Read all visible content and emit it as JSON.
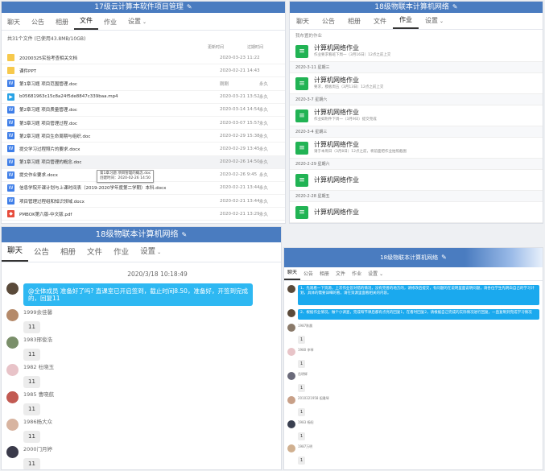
{
  "files_panel": {
    "title": "17级云计算本软件项目管理",
    "tabs": [
      {
        "label": "聊天"
      },
      {
        "label": "公告"
      },
      {
        "label": "相册"
      },
      {
        "label": "文件",
        "active": true
      },
      {
        "label": "作业"
      },
      {
        "label": "设置"
      }
    ],
    "summary": "共31个文件 (已使用43.8MB/10GB)",
    "columns": {
      "date": "更新时间",
      "expire": "过期时间"
    },
    "files": [
      {
        "type": "folder",
        "name": "20200325实验考查相关文档",
        "date": "2020-03-23 11:22",
        "expire": ""
      },
      {
        "type": "folder",
        "name": "课件PPT",
        "date": "2020-02-21 14:43",
        "expire": ""
      },
      {
        "type": "word",
        "name": "第1章习题 项目范围管理.doc",
        "date": "刚刚",
        "expire": "永久"
      },
      {
        "type": "video",
        "name": "b05681963c15c8a24f5de8847c339baa.mp4",
        "date": "2020-03-21 13:52",
        "expire": "永久"
      },
      {
        "type": "word",
        "name": "第2章习题 项目质量管理.doc",
        "date": "2020-03-14 14:54",
        "expire": "永久"
      },
      {
        "type": "word",
        "name": "第3章习题 项目管理过程.doc",
        "date": "2020-03-07 15:57",
        "expire": "永久"
      },
      {
        "type": "word",
        "name": "第2章习题 项目生命周期与组织.doc",
        "date": "2020-02-29 15:38",
        "expire": "永久"
      },
      {
        "type": "word",
        "name": "提交学习过程照片的要求.docx",
        "date": "2020-02-29 13:45",
        "expire": "永久"
      },
      {
        "type": "word",
        "name": "第1章习题 项目管理的概念.doc",
        "date": "2020-02-26 14:50",
        "expire": "永久",
        "selected": true
      },
      {
        "type": "word",
        "name": "提交作业要求.docx",
        "date": "2020-02-26 9:45",
        "expire": "永久"
      },
      {
        "type": "word",
        "name": "信息学院开课计划与上课时间表（2019-2020学年度第二学期）本科.docx",
        "date": "2020-02-21 13:44",
        "expire": "永久"
      },
      {
        "type": "word",
        "name": "项目管理过程组和知识领域.docx",
        "date": "2020-02-21 13:44",
        "expire": "永久"
      },
      {
        "type": "pdf",
        "name": "PMBOK第六版-中文版.pdf",
        "date": "2020-02-21 13:29",
        "expire": "永久"
      }
    ],
    "tooltip": {
      "line1": "第1章习题 项目管理的概念.doc",
      "line2": "创建时间：2020-02-26 14:50"
    }
  },
  "homework_panel": {
    "title": "18级物联本计算机网络",
    "tabs": [
      {
        "label": "聊天"
      },
      {
        "label": "公告"
      },
      {
        "label": "相册"
      },
      {
        "label": "文件"
      },
      {
        "label": "作业",
        "active": true
      },
      {
        "label": "设置"
      }
    ],
    "section": "我布置的作业",
    "items": [
      {
        "date": "",
        "title": "计算机网络作业",
        "sub": "作业要求看班下周一（3月16日）12点之前上交"
      },
      {
        "date": "2020-3-11 星期三",
        "title": "计算机网络作业",
        "sub": "要求，模板周五（3月13日）12点之前上交"
      },
      {
        "date": "2020-3-7 星期六",
        "title": "计算机网络作业",
        "sub": "作业如附件下周一（3月9日）提交完成"
      },
      {
        "date": "2020-3-4 星期三",
        "title": "计算机网络作业",
        "sub": "请于本周日（3月8日）12点之前，将前面把作业拍照截图"
      },
      {
        "date": "2020-2-29 星期六",
        "title": "计算机网络作业",
        "sub": ""
      },
      {
        "date": "2020-2-28 星期五",
        "title": "计算机网络作业",
        "sub": ""
      },
      {
        "date": "2020-2-26 星期三",
        "title": "计算机网络作业",
        "sub": ""
      }
    ]
  },
  "chat_panel": {
    "title": "18级物联本计算机网络",
    "tabs": [
      {
        "label": "聊天",
        "active": true
      },
      {
        "label": "公告"
      },
      {
        "label": "相册"
      },
      {
        "label": "文件"
      },
      {
        "label": "作业"
      },
      {
        "label": "设置"
      }
    ],
    "timestamp": "2020/3/18 10:18:49",
    "announcement": "@全体成员 准备好了吗? 直课室已开启签到，截止时间8.50，准备好，开签到完成的，回复11",
    "messages": [
      {
        "name": "1999余佳馨",
        "text": "11",
        "color": "#b58a6a"
      },
      {
        "name": "1983邢俊浩",
        "text": "11",
        "color": "#7a8f6a"
      },
      {
        "name": "1982 杜晓玉",
        "text": "11",
        "color": "#e8c3c8"
      },
      {
        "name": "1985 曹晓航",
        "text": "11",
        "color": "#c25a52"
      },
      {
        "name": "1986杨大众",
        "text": "11",
        "color": "#d8b4a0"
      },
      {
        "name": "2000门月婷",
        "text": "11",
        "color": "#3a3a4a"
      },
      {
        "name": "1990 李璐",
        "text": "",
        "color": "#a0a8b8"
      }
    ]
  },
  "small_chat_panel": {
    "title": "18级物联本计算机网络",
    "tabs": [
      {
        "label": "聊天",
        "active": true
      },
      {
        "label": "公告"
      },
      {
        "label": "相册"
      },
      {
        "label": "文件"
      },
      {
        "label": "作业"
      },
      {
        "label": "设置"
      }
    ],
    "announcement1": "1、先观看一下资源，上次作业答对错的情况，没有完善的地方的，请修改后提交，有问题的在说明里面说明问题，请各位学生先明白自己的学习计划，具体的需要详细的看，请在资源里面看相关的内容。",
    "announcement2": "2、根据作业情况，做个小调查，完成每节课后都有点亮的回复1，在看时回复2，请根据自己完成的实际情况进行回复，一直复制到完成学习情况",
    "messages": [
      {
        "name": "1987陈晨",
        "text": "1",
        "color": "#8a7a6a"
      },
      {
        "name": "1980 李琴",
        "text": "1",
        "color": "#e8c4c8"
      },
      {
        "name": "岳明辉",
        "text": "1",
        "color": "#6a6a7a"
      },
      {
        "name": "2010321958 祖雅琴",
        "text": "1",
        "color": "#c8a088"
      },
      {
        "name": "1983 杨阳",
        "text": "1",
        "color": "#3a4050"
      },
      {
        "name": "1987万明",
        "text": "1",
        "color": "#d0b090"
      }
    ]
  }
}
